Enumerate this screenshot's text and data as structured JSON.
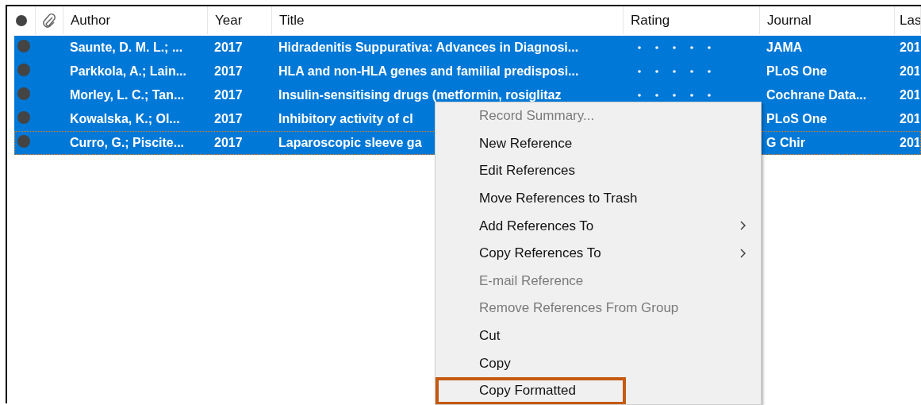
{
  "table": {
    "columns": [
      "Author",
      "Year",
      "Title",
      "Rating",
      "Journal",
      "Las"
    ],
    "rows": [
      {
        "unread": true,
        "selected": true,
        "focused": false,
        "author": "Saunte, D. M. L.; ...",
        "year": "2017",
        "title": "Hidradenitis Suppurativa: Advances in Diagnosi...",
        "rated": false,
        "journal": "JAMA",
        "column_8": "201"
      },
      {
        "unread": true,
        "selected": true,
        "focused": false,
        "author": "Parkkola, A.; Lain...",
        "year": "2017",
        "title": "HLA and non-HLA genes and familial predisposi...",
        "rated": false,
        "journal": "PLoS One",
        "column_8": "201"
      },
      {
        "unread": true,
        "selected": true,
        "focused": false,
        "author": "Morley, L. C.; Tan...",
        "year": "2017",
        "title": "Insulin-sensitising drugs (metformin, rosiglitaz",
        "rated": false,
        "journal": "Cochrane Data...",
        "column_8": "201"
      },
      {
        "unread": true,
        "selected": true,
        "focused": false,
        "author": "Kowalska, K.; Ol...",
        "year": "2017",
        "title": "Inhibitory activity of cl",
        "journal": "PLoS One",
        "column_8": "201"
      },
      {
        "unread": true,
        "selected": true,
        "focused": true,
        "author": "Curro, G.; Piscite...",
        "year": "2017",
        "title": "Laparoscopic sleeve ga",
        "journal": "G Chir",
        "column_8": "201"
      }
    ]
  },
  "context_menu": {
    "items": [
      {
        "label": "Record Summary...",
        "disabled": true,
        "submenu": false,
        "highlighted": false
      },
      {
        "label": "New Reference",
        "disabled": false,
        "submenu": false,
        "highlighted": false
      },
      {
        "label": "Edit References",
        "disabled": false,
        "submenu": false,
        "highlighted": false
      },
      {
        "label": "Move References to Trash",
        "disabled": false,
        "submenu": false,
        "highlighted": false
      },
      {
        "label": "Add References To",
        "disabled": false,
        "submenu": true,
        "highlighted": false
      },
      {
        "label": "Copy References To",
        "disabled": false,
        "submenu": true,
        "highlighted": false
      },
      {
        "label": "E-mail Reference",
        "disabled": true,
        "submenu": false,
        "highlighted": false
      },
      {
        "label": "Remove References From Group",
        "disabled": true,
        "submenu": false,
        "highlighted": false
      },
      {
        "label": "Cut",
        "disabled": false,
        "submenu": false,
        "highlighted": false
      },
      {
        "label": "Copy",
        "disabled": false,
        "submenu": false,
        "highlighted": false
      },
      {
        "label": "Copy Formatted",
        "disabled": false,
        "submenu": false,
        "highlighted": true
      }
    ]
  }
}
